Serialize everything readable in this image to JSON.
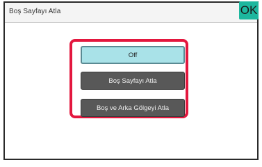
{
  "dialog": {
    "title": "Boş Sayfayı Atla",
    "ok_label": "OK"
  },
  "options": [
    {
      "label": "Off",
      "selected": true
    },
    {
      "label": "Boş Sayfayı Atla",
      "selected": false
    },
    {
      "label": "Boş ve Arka Gölgeyi Atla",
      "selected": false
    }
  ],
  "colors": {
    "ok_button": "#1db79e",
    "selected_option": "#a9e2e8",
    "option": "#585858",
    "highlight_border": "#e3173e"
  }
}
